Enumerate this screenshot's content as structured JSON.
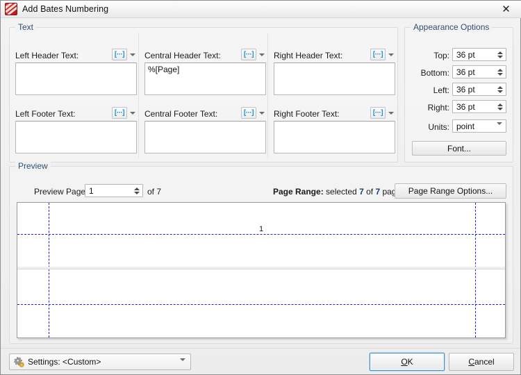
{
  "window": {
    "title": "Add Bates Numbering",
    "icon": "pdf-app-icon",
    "close_label": "✕"
  },
  "text_group": {
    "label": "Text",
    "macro_button_label": "[···]",
    "fields": [
      {
        "label": "Left Header Text:",
        "value": ""
      },
      {
        "label": "Central Header Text:",
        "value": "%[Page]"
      },
      {
        "label": "Right Header Text:",
        "value": ""
      },
      {
        "label": "Left Footer Text:",
        "value": ""
      },
      {
        "label": "Central Footer Text:",
        "value": ""
      },
      {
        "label": "Right Footer Text:",
        "value": ""
      }
    ]
  },
  "appearance": {
    "label": "Appearance Options",
    "margins": [
      {
        "label": "Top:",
        "value": "36 pt"
      },
      {
        "label": "Bottom:",
        "value": "36 pt"
      },
      {
        "label": "Left:",
        "value": "36 pt"
      },
      {
        "label": "Right:",
        "value": "36 pt"
      }
    ],
    "units_label": "Units:",
    "units_value": "point",
    "font_button": "Font..."
  },
  "preview": {
    "label": "Preview",
    "page_label": "Preview Page",
    "page_value": "1",
    "of_label": "of 7",
    "range_prefix": "Page Range:",
    "range_mid": " selected ",
    "range_selected": "7",
    "range_join": " of ",
    "range_total": "7",
    "range_suffix": " pages",
    "range_button": "Page Range Options...",
    "page_number_text": "1",
    "guide_color": "#2020ee"
  },
  "footer": {
    "settings_label": "Settings:",
    "settings_value": "<Custom>",
    "settings_icon": "gears-icon",
    "ok_pre": "",
    "ok_acc": "O",
    "ok_post": "K",
    "cancel_pre": "",
    "cancel_acc": "C",
    "cancel_post": "ancel"
  }
}
